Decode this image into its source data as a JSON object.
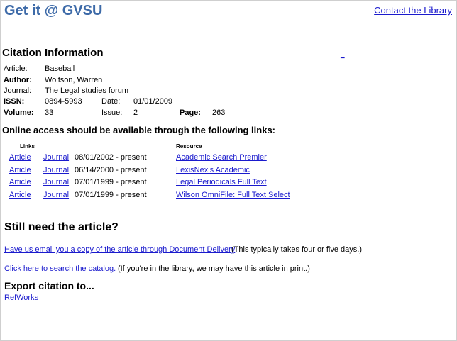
{
  "header": {
    "site_title": "Get it @ GVSU",
    "contact_link": "Contact the Library"
  },
  "citation": {
    "heading": "Citation Information",
    "article_label": "Article:",
    "article": "Baseball",
    "author_label": "Author:",
    "author": "Wolfson, Warren",
    "journal_label": "Journal:",
    "journal": "The Legal studies forum",
    "issn_label": "ISSN:",
    "issn": "0894-5993",
    "date_label": "Date:",
    "date": "01/01/2009",
    "volume_label": "Volume:",
    "volume": "33",
    "issue_label": "Issue:",
    "issue": "2",
    "page_label": "Page:",
    "page": "263",
    "side_link": "_"
  },
  "access": {
    "heading": "Online access should be available through the following links:",
    "col_links": "Links",
    "col_resource": "Resource",
    "rows": [
      {
        "article": "Article",
        "journal": "Journal",
        "coverage": "08/01/2002 - present",
        "resource": "Academic Search Premier"
      },
      {
        "article": "Article",
        "journal": "Journal",
        "coverage": "06/14/2000 - present",
        "resource": "LexisNexis Academic"
      },
      {
        "article": "Article",
        "journal": "Journal",
        "coverage": "07/01/1999 - present",
        "resource": "Legal Periodicals Full Text"
      },
      {
        "article": "Article",
        "journal": "Journal",
        "coverage": "07/01/1999 - present",
        "resource": "Wilson OmniFile: Full Text Select"
      }
    ]
  },
  "still_need": {
    "heading": "Still need the article?",
    "doc_delivery_link": "Have us email you a copy of the article through Document Delivery",
    "doc_delivery_note": "(This typically takes four or five days.)",
    "catalog_link": "Click here to search the catalog.",
    "catalog_note": "(If you're in the library, we may have this article in print.)"
  },
  "export": {
    "heading": "Export citation to...",
    "refworks_link": "RefWorks"
  }
}
